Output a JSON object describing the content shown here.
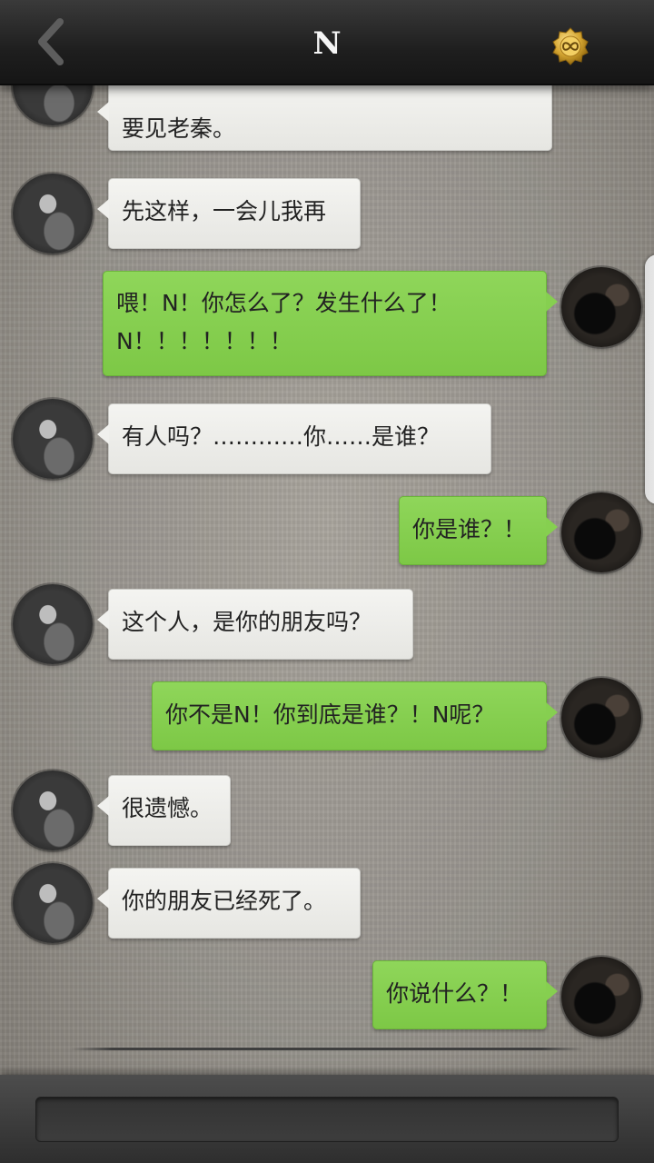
{
  "header": {
    "title": "N",
    "back_icon": "chevron-left-icon",
    "badge_icon": "infinity-coin-icon",
    "badge_color": "#d4a531"
  },
  "messages": [
    {
      "side": "other",
      "lines": [
        "要见老秦。"
      ]
    },
    {
      "side": "other",
      "lines": [
        "先这样，一会儿我再"
      ]
    },
    {
      "side": "me",
      "lines": [
        "喂！N！你怎么了？发生什么了！",
        "N！！！！！！！"
      ]
    },
    {
      "side": "other",
      "lines": [
        "有人吗？…………你……是谁？"
      ]
    },
    {
      "side": "me",
      "lines": [
        "你是谁？！"
      ]
    },
    {
      "side": "other",
      "lines": [
        "这个人，是你的朋友吗？"
      ]
    },
    {
      "side": "me",
      "lines": [
        "你不是N！你到底是谁？！N呢？"
      ]
    },
    {
      "side": "other",
      "lines": [
        "很遗憾。"
      ]
    },
    {
      "side": "other",
      "lines": [
        "你的朋友已经死了。"
      ]
    },
    {
      "side": "me",
      "lines": [
        "你说什么？！"
      ]
    }
  ],
  "composer": {
    "input_value": ""
  },
  "colors": {
    "my_bubble": "#86cf50",
    "other_bubble": "#eeeeeb",
    "topbar": "#222222"
  }
}
